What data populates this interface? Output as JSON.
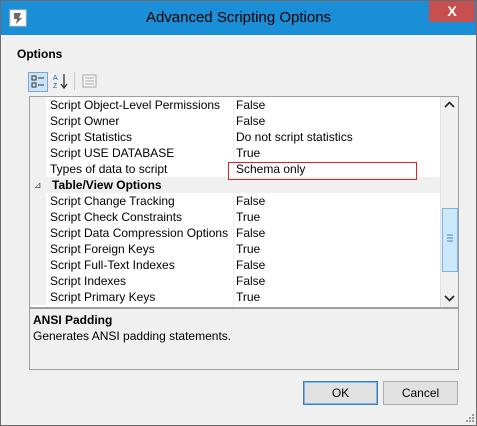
{
  "window": {
    "title": "Advanced Scripting Options",
    "close_label": "X"
  },
  "section_label": "Options",
  "toolbar": {
    "categorized": "categorized-icon",
    "alphabetical": "alphabetical-sort-icon",
    "property_pages": "property-pages-icon"
  },
  "grid": {
    "rows": [
      {
        "name": "Script Object-Level Permissions",
        "value": "False"
      },
      {
        "name": "Script Owner",
        "value": "False"
      },
      {
        "name": "Script Statistics",
        "value": "Do not script statistics"
      },
      {
        "name": "Script USE DATABASE",
        "value": "True"
      },
      {
        "name": "Types of data to script",
        "value": "Schema only"
      }
    ],
    "category": {
      "name": "Table/View Options",
      "expander": "⊿"
    },
    "table_rows": [
      {
        "name": "Script Change Tracking",
        "value": "False"
      },
      {
        "name": "Script Check Constraints",
        "value": "True"
      },
      {
        "name": "Script Data Compression Options",
        "value": "False"
      },
      {
        "name": "Script Foreign Keys",
        "value": "True"
      },
      {
        "name": "Script Full-Text Indexes",
        "value": "False"
      },
      {
        "name": "Script Indexes",
        "value": "False"
      },
      {
        "name": "Script Primary Keys",
        "value": "True"
      }
    ]
  },
  "description": {
    "title": "ANSI Padding",
    "text": "Generates ANSI padding statements."
  },
  "buttons": {
    "ok": "OK",
    "cancel": "Cancel"
  },
  "colors": {
    "titlebar": "#1a8ed6",
    "close": "#c74f4f",
    "highlight": "#d0262a"
  }
}
